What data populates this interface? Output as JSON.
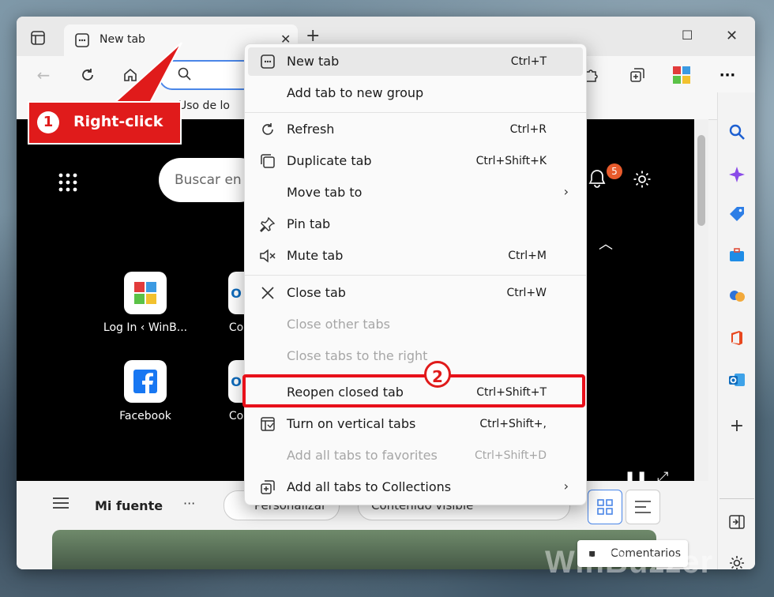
{
  "tab": {
    "title": "New tab"
  },
  "favorites": {
    "item": "Uso de lo"
  },
  "newtab_page": {
    "search_placeholder": "Buscar en",
    "notification_count": "5",
    "tiles": [
      {
        "label": "Log In ‹ WinB..."
      },
      {
        "label": "Co"
      },
      {
        "label": "Facebook"
      },
      {
        "label": "Co"
      }
    ]
  },
  "feed": {
    "title": "Mi fuente",
    "more": "···",
    "personalize": "Personalizar",
    "content_visible": "Contenido visible",
    "comments": "Comentarios"
  },
  "context_menu": {
    "items": [
      {
        "label": "New tab",
        "shortcut": "Ctrl+T",
        "icon": "new-tab-icon"
      },
      {
        "label": "Add tab to new group",
        "shortcut": "",
        "icon": ""
      },
      {
        "label": "Refresh",
        "shortcut": "Ctrl+R",
        "icon": "refresh-icon"
      },
      {
        "label": "Duplicate tab",
        "shortcut": "Ctrl+Shift+K",
        "icon": "duplicate-icon"
      },
      {
        "label": "Move tab to",
        "shortcut": "",
        "icon": ""
      },
      {
        "label": "Pin tab",
        "shortcut": "",
        "icon": "pin-icon"
      },
      {
        "label": "Mute tab",
        "shortcut": "Ctrl+M",
        "icon": "mute-icon"
      },
      {
        "label": "Close tab",
        "shortcut": "Ctrl+W",
        "icon": "close-icon"
      },
      {
        "label": "Close other tabs",
        "shortcut": "",
        "icon": ""
      },
      {
        "label": "Close tabs to the right",
        "shortcut": "",
        "icon": ""
      },
      {
        "label": "Reopen closed tab",
        "shortcut": "Ctrl+Shift+T",
        "icon": ""
      },
      {
        "label": "Turn on vertical tabs",
        "shortcut": "Ctrl+Shift+,",
        "icon": "vertical-tabs-icon"
      },
      {
        "label": "Add all tabs to favorites",
        "shortcut": "Ctrl+Shift+D",
        "icon": ""
      },
      {
        "label": "Add all tabs to Collections",
        "shortcut": "",
        "icon": "collections-icon"
      }
    ]
  },
  "annotations": {
    "step1_num": "1",
    "step1_text": "Right-click",
    "step2_num": "2"
  },
  "watermark": "WinBuzzer",
  "colors": {
    "annotation_red": "#e01b1b",
    "accent_blue": "#4a86e8"
  }
}
